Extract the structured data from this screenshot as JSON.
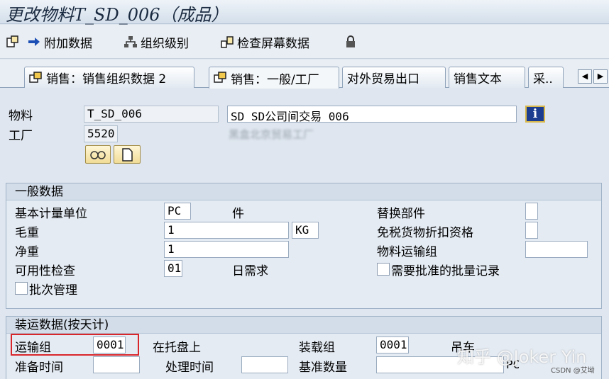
{
  "window": {
    "title": "更改物料T_SD_006（成品）"
  },
  "toolbar": {
    "additional_data": "附加数据",
    "org_levels": "组织级别",
    "check_screen_data": "检查屏幕数据"
  },
  "tabs": [
    {
      "label": "销售：销售组织数据 2"
    },
    {
      "label": "销售：一般/工厂"
    },
    {
      "label": "对外贸易出口"
    },
    {
      "label": "销售文本"
    },
    {
      "label": "采.."
    }
  ],
  "tab_nav": {
    "prev": "◀",
    "next": "▶"
  },
  "header": {
    "material_label": "物料",
    "material_value": "T_SD_006",
    "material_desc": "SD SD公司间交易 006",
    "plant_label": "工厂",
    "plant_value": "5520",
    "plant_desc_blurred": "黑盒北京贸易工厂"
  },
  "general": {
    "title": "一般数据",
    "base_uom_label": "基本计量单位",
    "base_uom_value": "PC",
    "base_uom_text": "件",
    "gross_weight_label": "毛重",
    "gross_weight_value": "1",
    "weight_unit": "KG",
    "net_weight_label": "净重",
    "net_weight_value": "1",
    "availability_label": "可用性检查",
    "availability_value": "01",
    "availability_text": "日需求",
    "batch_mgmt_label": "批次管理",
    "replacement_part_label": "替换部件",
    "duty_free_label": "免税货物折扣资格",
    "mat_freight_group_label": "物料运输组",
    "approved_batch_label": "需要批准的批量记录"
  },
  "shipping": {
    "title": "装运数据(按天计)",
    "trans_group_label": "运输组",
    "trans_group_value": "0001",
    "trans_group_text": "在托盘上",
    "loading_group_label": "装载组",
    "loading_group_value": "0001",
    "loading_group_text": "吊车",
    "setup_time_label": "准备时间",
    "proc_time_label": "处理时间",
    "base_qty_label": "基准数量",
    "base_qty_unit": "PC"
  },
  "overlay": {
    "watermark": "知乎 @Joker Yin",
    "credit": "CSDN @艾坳"
  },
  "colors": {
    "highlight": "#d8262b",
    "info_button": "#1c3d8f"
  }
}
